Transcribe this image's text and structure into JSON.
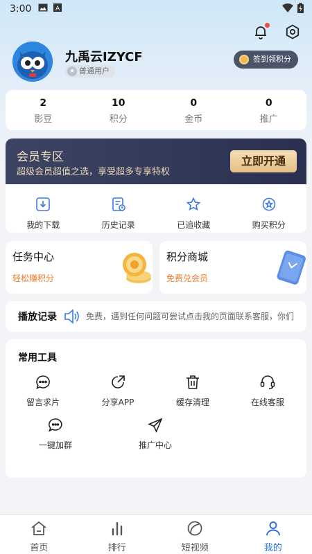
{
  "status": {
    "time": "3:00"
  },
  "user": {
    "name": "九禹云IZYCF",
    "level": "普通用户",
    "sign_button": "签到领积分"
  },
  "stats": [
    {
      "value": "2",
      "label": "影豆"
    },
    {
      "value": "10",
      "label": "积分"
    },
    {
      "value": "0",
      "label": "金币"
    },
    {
      "value": "0",
      "label": "推广"
    }
  ],
  "vip": {
    "title": "会员专区",
    "subtitle": "超级会员超值之选，享受超多专享特权",
    "button": "立即开通"
  },
  "actions": [
    {
      "label": "我的下载",
      "icon": "download-icon"
    },
    {
      "label": "历史记录",
      "icon": "history-icon"
    },
    {
      "label": "已追收藏",
      "icon": "star-icon"
    },
    {
      "label": "购买积分",
      "icon": "points-icon"
    }
  ],
  "task_center": {
    "title": "任务中心",
    "subtitle": "轻松赚积分"
  },
  "points_mall": {
    "title": "积分商城",
    "subtitle": "免费兑会员"
  },
  "play_history": {
    "title": "播放记录",
    "notice": "免费，遇到任何问题可尝试点击我的页面联系客服，你们"
  },
  "tools": {
    "title": "常用工具",
    "items": [
      {
        "label": "留言求片",
        "icon": "message-icon"
      },
      {
        "label": "分享APP",
        "icon": "share-icon"
      },
      {
        "label": "缓存清理",
        "icon": "trash-icon"
      },
      {
        "label": "在线客服",
        "icon": "headset-icon"
      },
      {
        "label": "一键加群",
        "icon": "group-chat-icon"
      },
      {
        "label": "推广中心",
        "icon": "send-icon"
      }
    ]
  },
  "tabs": [
    {
      "label": "首页",
      "icon": "home-icon"
    },
    {
      "label": "排行",
      "icon": "ranking-icon"
    },
    {
      "label": "短视频",
      "icon": "short-video-icon"
    },
    {
      "label": "我的",
      "icon": "profile-icon",
      "active": true
    }
  ],
  "colors": {
    "accent": "#2b6fd6",
    "vip_bg": "#3d4463",
    "vip_gold": "#e4bf86",
    "orange": "#ef7d2c"
  }
}
